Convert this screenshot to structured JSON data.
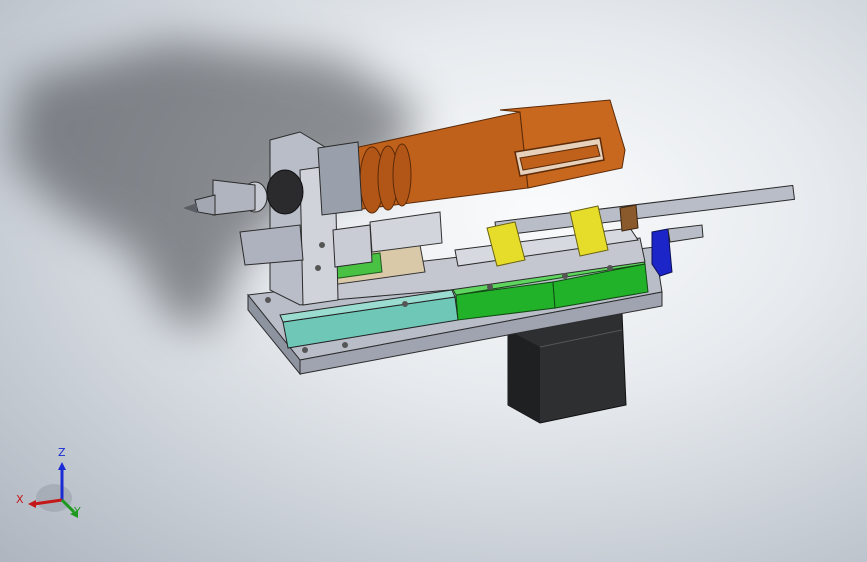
{
  "triad": {
    "z_label": "Z",
    "x_label": "X",
    "y_label": "Y",
    "colors": {
      "x": "#c41818",
      "y": "#1d9a1d",
      "z": "#1a2bd6"
    }
  },
  "colors": {
    "spindle_orange": "#c0611b",
    "frame_grey": "#b8bcc7",
    "rail_green": "#22b22a",
    "block_cyan": "#6fc7b8",
    "clamp_yellow": "#e6dc2a",
    "knob_blue": "#1c25c8",
    "motor_black": "#2e2f31"
  }
}
